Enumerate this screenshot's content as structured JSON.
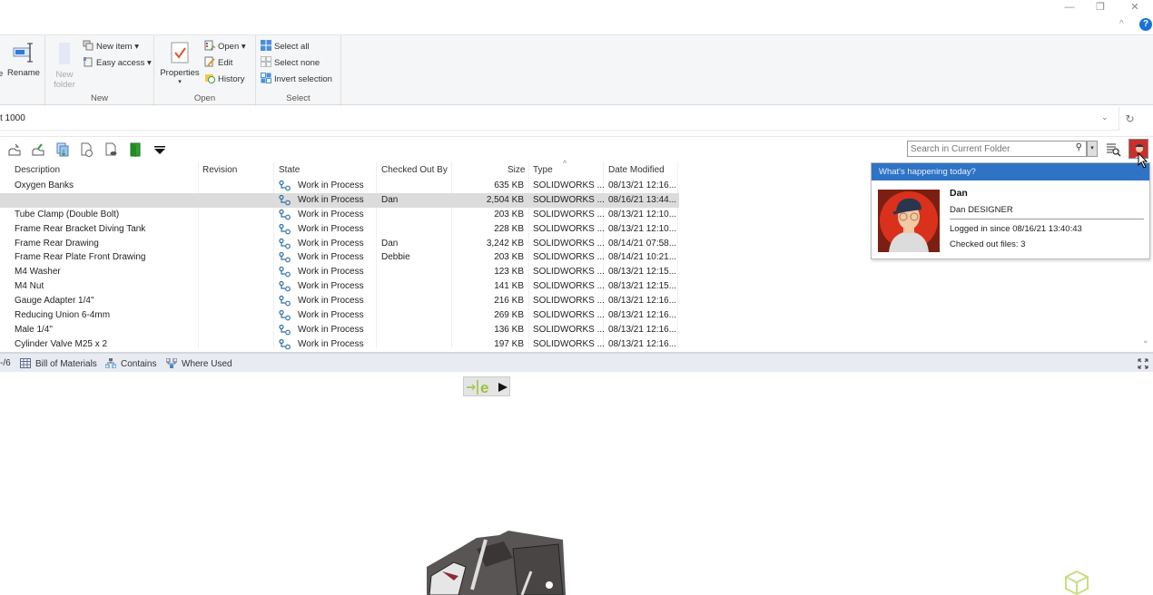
{
  "window": {
    "minimize_icon": "—",
    "restore_icon": "❐",
    "close_icon": "✕",
    "collapse_ribbon_icon": "^",
    "help_icon": "?"
  },
  "ribbon": {
    "organize": {
      "rename_label": "Rename",
      "partial_label": "e"
    },
    "new_group": {
      "label": "New",
      "new_folder_label": "New folder",
      "new_folder_line1": "New",
      "new_folder_line2": "folder",
      "new_item_label": "New item ▾",
      "easy_access_label": "Easy access ▾"
    },
    "open_group": {
      "label": "Open",
      "properties_label": "Properties",
      "properties_arrow": "▾",
      "open_label": "Open ▾",
      "edit_label": "Edit",
      "history_label": "History"
    },
    "select_group": {
      "label": "Select",
      "select_all_label": "Select all",
      "select_none_label": "Select none",
      "invert_selection_label": "Invert selection"
    }
  },
  "address": {
    "path_text": "t 1000",
    "dropdown_icon": "⌄",
    "refresh_icon": "↻"
  },
  "search": {
    "placeholder": "Search in Current Folder",
    "search_icon": "🔍",
    "dropdown_icon": "▾"
  },
  "columns": {
    "description": "Description",
    "revision": "Revision",
    "state": "State",
    "checked_out_by": "Checked Out By",
    "size": "Size",
    "type": "Type",
    "date_modified": "Date Modified",
    "sort_indicator": "^"
  },
  "rows": [
    {
      "description": "Oxygen Banks",
      "revision": "",
      "state": "Work in Process",
      "checked_out_by": "",
      "size": "635 KB",
      "type": "SOLIDWORKS ...",
      "date_modified": "08/13/21 12:16...",
      "selected": false
    },
    {
      "description": "",
      "revision": "",
      "state": "Work in Process",
      "checked_out_by": "Dan",
      "size": "2,504 KB",
      "type": "SOLIDWORKS ...",
      "date_modified": "08/16/21 13:44...",
      "selected": true
    },
    {
      "description": "Tube Clamp (Double Bolt)",
      "revision": "",
      "state": "Work in Process",
      "checked_out_by": "",
      "size": "203 KB",
      "type": "SOLIDWORKS ...",
      "date_modified": "08/13/21 12:10...",
      "selected": false
    },
    {
      "description": "Frame Rear Bracket Diving Tank",
      "revision": "",
      "state": "Work in Process",
      "checked_out_by": "",
      "size": "228 KB",
      "type": "SOLIDWORKS ...",
      "date_modified": "08/13/21 12:10...",
      "selected": false
    },
    {
      "description": "Frame Rear Drawing",
      "revision": "",
      "state": "Work in Process",
      "checked_out_by": "Dan",
      "size": "3,242 KB",
      "type": "SOLIDWORKS ...",
      "date_modified": "08/14/21 07:58...",
      "selected": false
    },
    {
      "description": "Frame Rear Plate Front Drawing",
      "revision": "",
      "state": "Work in Process",
      "checked_out_by": "Debbie",
      "size": "203 KB",
      "type": "SOLIDWORKS ...",
      "date_modified": "08/14/21 10:21...",
      "selected": false
    },
    {
      "description": "M4 Washer",
      "revision": "",
      "state": "Work in Process",
      "checked_out_by": "",
      "size": "123 KB",
      "type": "SOLIDWORKS ...",
      "date_modified": "08/13/21 12:15...",
      "selected": false
    },
    {
      "description": "M4 Nut",
      "revision": "",
      "state": "Work in Process",
      "checked_out_by": "",
      "size": "141 KB",
      "type": "SOLIDWORKS ...",
      "date_modified": "08/13/21 12:15...",
      "selected": false
    },
    {
      "description": "Gauge Adapter 1/4\"",
      "revision": "",
      "state": "Work in Process",
      "checked_out_by": "",
      "size": "216 KB",
      "type": "SOLIDWORKS ...",
      "date_modified": "08/13/21 12:16...",
      "selected": false
    },
    {
      "description": "Reducing Union 6-4mm",
      "revision": "",
      "state": "Work in Process",
      "checked_out_by": "",
      "size": "269 KB",
      "type": "SOLIDWORKS ...",
      "date_modified": "08/13/21 12:16...",
      "selected": false
    },
    {
      "description": "Male 1/4\"",
      "revision": "",
      "state": "Work in Process",
      "checked_out_by": "",
      "size": "136 KB",
      "type": "SOLIDWORKS ...",
      "date_modified": "08/13/21 12:16...",
      "selected": false
    },
    {
      "description": "Cylinder Valve M25 x 2",
      "revision": "",
      "state": "Work in Process",
      "checked_out_by": "",
      "size": "197 KB",
      "type": "SOLIDWORKS ...",
      "date_modified": "08/13/21 12:16...",
      "selected": false
    }
  ],
  "bottom_tabs": {
    "partial_label": "-/6",
    "bill_of_materials": "Bill of Materials",
    "contains": "Contains",
    "where_used": "Where Used"
  },
  "popup": {
    "header": "What's happening today?",
    "name": "Dan",
    "role": "Dan DESIGNER",
    "logged_in": "Logged in since 08/16/21 13:40:43",
    "checked_out": "Checked out files: 3"
  },
  "colors": {
    "popup_header_bg": "#2f73c6",
    "avatar_red": "#d9311c",
    "selected_row": "#dcdcdc",
    "edrawings_green": "#9bc23c",
    "help_blue": "#1a73d6"
  }
}
